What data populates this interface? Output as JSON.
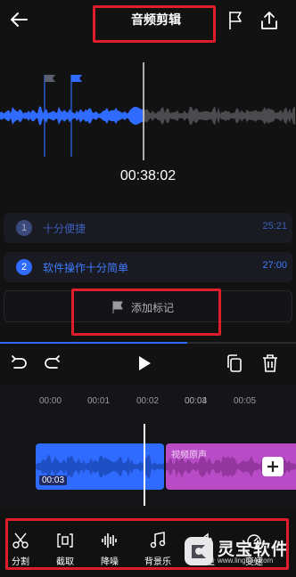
{
  "header": {
    "title": "音频剪辑"
  },
  "player": {
    "time": "00:38:02"
  },
  "markers": [
    {
      "index": "1",
      "label": "十分便捷",
      "time": "25:21"
    },
    {
      "index": "2",
      "label": "软件操作十分简单",
      "time": "27:00"
    }
  ],
  "add_marker": {
    "label": "添加标记"
  },
  "timeline": {
    "ticks": [
      "00:00",
      "00:01",
      "00:02",
      "00:03",
      "00:04",
      "00:05"
    ],
    "clip1_time": "00:03",
    "clip2_label": "视频原声"
  },
  "tools": [
    {
      "label": "分割",
      "icon": "scissors-icon"
    },
    {
      "label": "截取",
      "icon": "crop-icon"
    },
    {
      "label": "降噪",
      "icon": "noise-reduction-icon"
    },
    {
      "label": "背景乐",
      "icon": "music-note-icon"
    },
    {
      "label": "音量",
      "icon": "volume-icon"
    },
    {
      "label": "变速",
      "icon": "speed-icon"
    }
  ],
  "watermark": {
    "text": "灵宝软件",
    "sub": "www.lingbao.com"
  },
  "colors": {
    "accent": "#2f6bff",
    "clip_purple": "#b84bc6",
    "highlight_red": "#e01e2b"
  }
}
